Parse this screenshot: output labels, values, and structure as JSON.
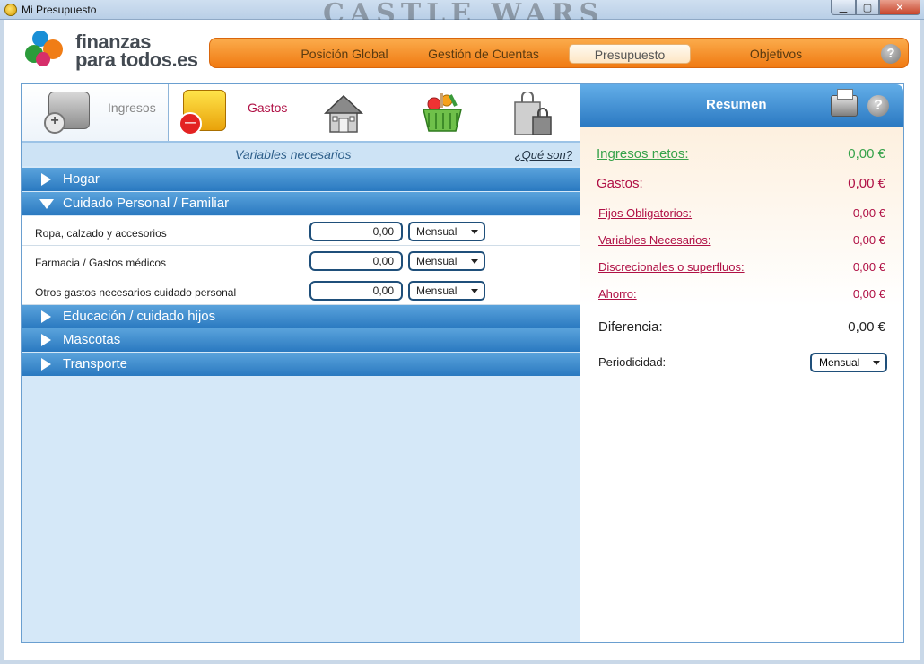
{
  "window": {
    "title": "Mi Presupuesto",
    "background_text": "CASTLE WARS",
    "buttons": {
      "minimize": "▁",
      "maximize": "▢",
      "close": "✕"
    }
  },
  "logo": {
    "line1": "finanzas",
    "line2": "para todos.es"
  },
  "nav": {
    "items": [
      "Posición Global",
      "Gestión de Cuentas",
      "Presupuesto",
      "Objetivos"
    ],
    "active": "Presupuesto",
    "help": "?"
  },
  "categories": {
    "ingresos": "Ingresos",
    "gastos": "Gastos"
  },
  "subheader": {
    "title": "Variables necesarios",
    "link": "¿Qué son?"
  },
  "groups": [
    "Hogar",
    "Cuidado Personal / Familiar",
    "Educación / cuidado hijos",
    "Mascotas",
    "Transporte"
  ],
  "items": [
    {
      "name": "Ropa, calzado y accesorios",
      "amount": "0,00",
      "period": "Mensual"
    },
    {
      "name": "Farmacia / Gastos médicos",
      "amount": "0,00",
      "period": "Mensual"
    },
    {
      "name": "Otros gastos necesarios cuidado personal",
      "amount": "0,00",
      "period": "Mensual"
    }
  ],
  "summary": {
    "title": "Resumen",
    "help": "?",
    "ingresos_label": "Ingresos netos:",
    "ingresos_value": "0,00 €",
    "gastos_label": "Gastos:",
    "gastos_value": "0,00 €",
    "fijos_label": "Fijos Obligatorios:",
    "fijos_value": "0,00 €",
    "variables_label": "Variables Necesarios:",
    "variables_value": "0,00 €",
    "discrecionales_label": "Discrecionales o superfluos:",
    "discrecionales_value": "0,00 €",
    "ahorro_label": "Ahorro:",
    "ahorro_value": "0,00 €",
    "diferencia_label": "Diferencia:",
    "diferencia_value": "0,00 €",
    "periodicidad_label": "Periodicidad:",
    "periodicidad_value": "Mensual"
  },
  "colors": {
    "accent_orange": "#f07a12",
    "accent_blue": "#2a79c0",
    "green": "#36a24a",
    "red": "#b01045"
  }
}
